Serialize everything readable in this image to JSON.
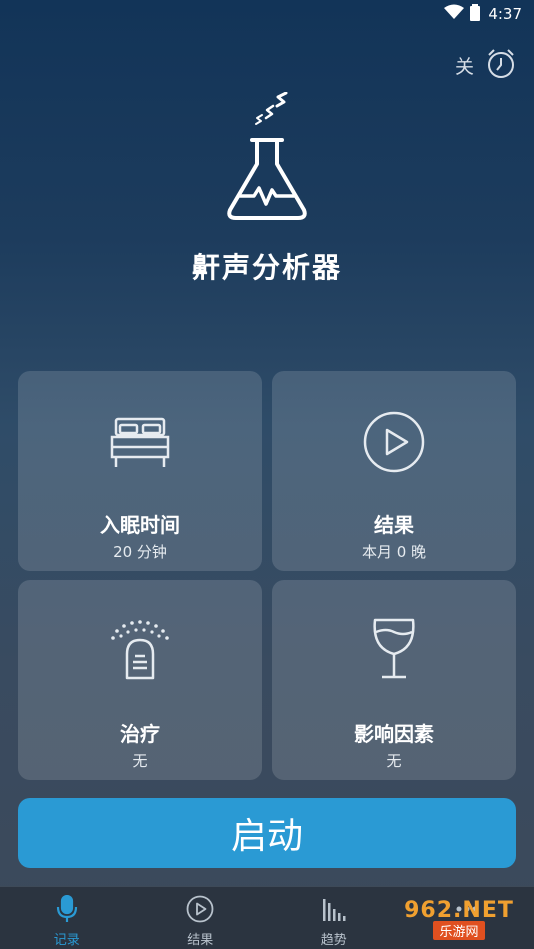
{
  "status_bar": {
    "time": "4:37",
    "icons": [
      "wifi-icon",
      "battery-icon"
    ]
  },
  "alarm": {
    "label": "关",
    "icon": "alarm-clock-icon"
  },
  "app": {
    "title": "鼾声分析器",
    "logo_icon": "flask-sleep-icon"
  },
  "cards": [
    {
      "label": "入眠时间",
      "sub": "20 分钟",
      "icon": "bed-icon"
    },
    {
      "label": "结果",
      "sub": "本月 0 晚",
      "icon": "play-circle-icon"
    },
    {
      "label": "治疗",
      "sub": "无",
      "icon": "device-icon"
    },
    {
      "label": "影响因素",
      "sub": "无",
      "icon": "wine-glass-icon"
    }
  ],
  "start_button": {
    "label": "启动"
  },
  "bottom_nav": [
    {
      "label": "记录",
      "icon": "microphone-icon",
      "active": true
    },
    {
      "label": "结果",
      "icon": "play-circle-icon",
      "active": false
    },
    {
      "label": "趋势",
      "icon": "bar-chart-icon",
      "active": false
    },
    {
      "label": "",
      "icon": "more-icon",
      "active": false
    }
  ],
  "watermark": {
    "top": "962.NET",
    "bottom": "乐游网"
  },
  "colors": {
    "accent": "#2a9ad4",
    "card_bg": "rgba(255,255,255,0.14)",
    "nav_bg": "#2b3440"
  }
}
